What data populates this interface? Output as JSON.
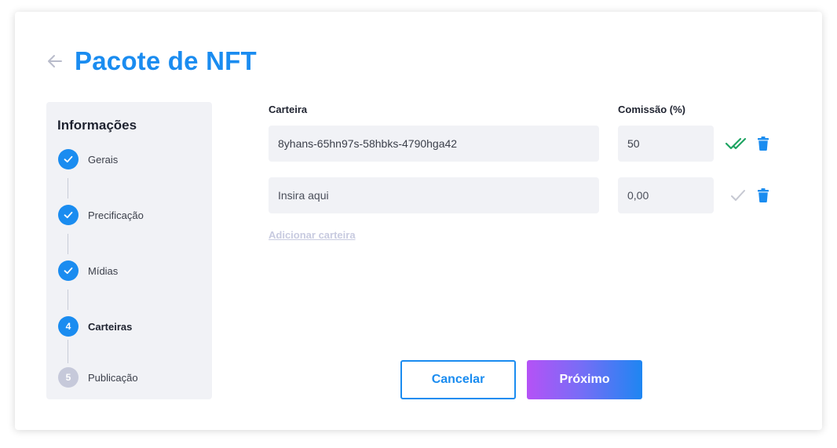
{
  "header": {
    "title": "Pacote de NFT"
  },
  "stepper": {
    "title": "Informações",
    "steps": [
      {
        "label": "Gerais",
        "marker": "",
        "state": "done"
      },
      {
        "label": "Precificação",
        "marker": "",
        "state": "done"
      },
      {
        "label": "Mídias",
        "marker": "",
        "state": "done"
      },
      {
        "label": "Carteiras",
        "marker": "4",
        "state": "active"
      },
      {
        "label": "Publicação",
        "marker": "5",
        "state": "pending"
      }
    ]
  },
  "wallets": {
    "column_wallet": "Carteira",
    "column_commission": "Comissão (%)",
    "rows": [
      {
        "wallet_value": "8yhans-65hn97s-58hbks-4790hga42",
        "wallet_placeholder": "",
        "commission_value": "50",
        "commission_placeholder": "",
        "status_icon": "double-check-icon"
      },
      {
        "wallet_value": "",
        "wallet_placeholder": "Insira aqui",
        "commission_value": "",
        "commission_placeholder": "0,00",
        "status_icon": "check-icon"
      }
    ],
    "add_label": "Adicionar carteira"
  },
  "actions": {
    "cancel_label": "Cancelar",
    "next_label": "Próximo"
  },
  "colors": {
    "primary": "#1a8cf0",
    "success": "#1fa463",
    "muted_check": "#c6c8d2",
    "gradient_start": "#b552f6",
    "gradient_end": "#1e86f2"
  }
}
